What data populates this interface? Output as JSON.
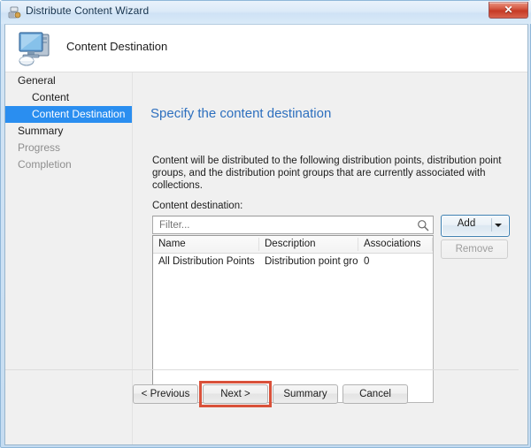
{
  "window": {
    "title": "Distribute Content Wizard",
    "title_icon": "distribute-content-icon",
    "close_label": "✕"
  },
  "header": {
    "icon": "computer-monitor-icon",
    "title": "Content Destination"
  },
  "nav": {
    "items": [
      {
        "label": "General",
        "indent": false,
        "state": "normal"
      },
      {
        "label": "Content",
        "indent": true,
        "state": "normal"
      },
      {
        "label": "Content Destination",
        "indent": true,
        "state": "selected"
      },
      {
        "label": "Summary",
        "indent": false,
        "state": "normal"
      },
      {
        "label": "Progress",
        "indent": false,
        "state": "disabled"
      },
      {
        "label": "Completion",
        "indent": false,
        "state": "disabled"
      }
    ]
  },
  "content": {
    "heading": "Specify the content destination",
    "description": "Content will be distributed to the following distribution points, distribution point groups, and the distribution point groups that are currently associated with collections.",
    "field_label": "Content destination:",
    "filter": {
      "placeholder": "Filter...",
      "value": "",
      "icon": "search-icon"
    },
    "buttons": {
      "add": "Add",
      "add_dropdown_icon": "chevron-down-icon",
      "remove": "Remove",
      "remove_enabled": false
    },
    "table": {
      "columns": [
        "Name",
        "Description",
        "Associations"
      ],
      "rows": [
        [
          "All Distribution Points",
          "Distribution point group",
          "0"
        ]
      ]
    }
  },
  "footer": {
    "previous": "< Previous",
    "next": "Next >",
    "summary": "Summary",
    "cancel": "Cancel"
  },
  "colors": {
    "accent": "#2d6fbe",
    "selection": "#2a8ef0",
    "highlight_box": "#d9513a",
    "close_button": "#c63a26"
  }
}
